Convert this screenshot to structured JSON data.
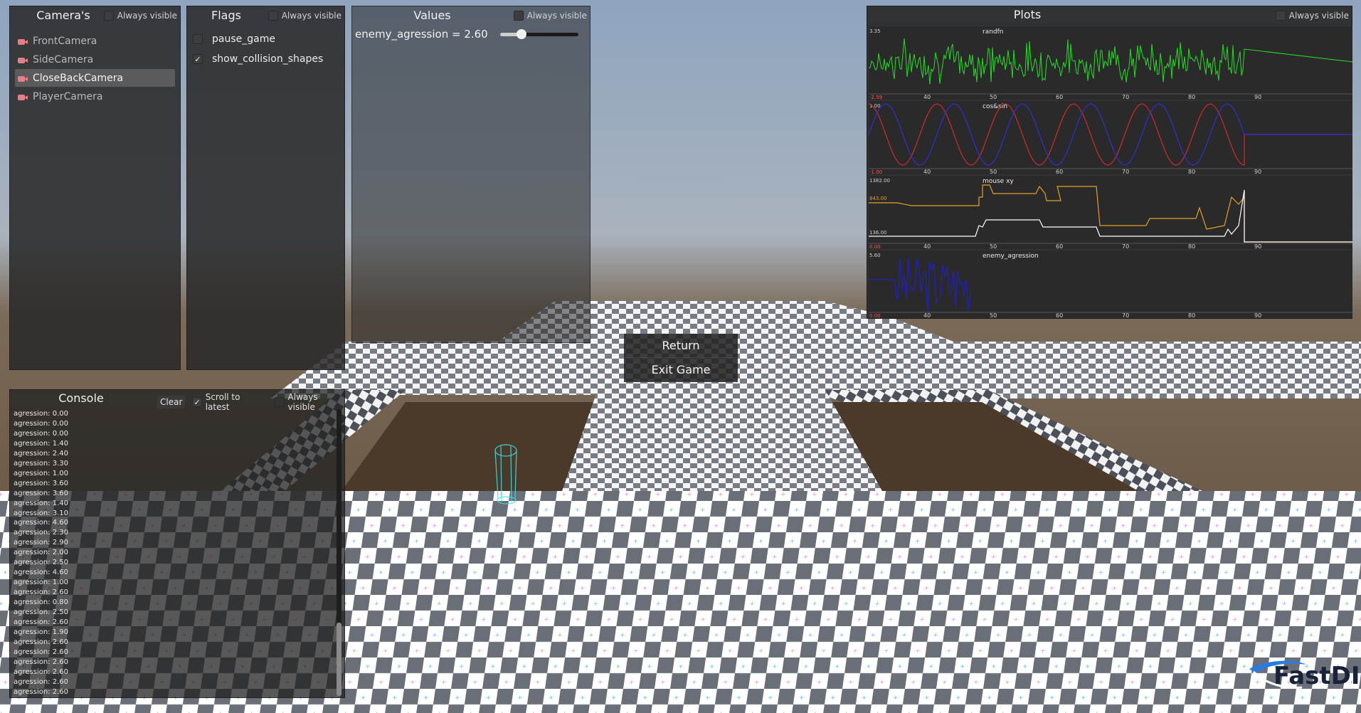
{
  "cameras": {
    "title": "Camera's",
    "always_visible": "Always visible",
    "items": [
      {
        "label": "FrontCamera",
        "active": false
      },
      {
        "label": "SideCamera",
        "active": false
      },
      {
        "label": "CloseBackCamera",
        "active": true
      },
      {
        "label": "PlayerCamera",
        "active": false
      }
    ]
  },
  "flags": {
    "title": "Flags",
    "always_visible": "Always visible",
    "items": [
      {
        "label": "pause_game",
        "checked": false
      },
      {
        "label": "show_collision_shapes",
        "checked": true
      }
    ]
  },
  "values": {
    "title": "Values",
    "always_visible": "Always visible",
    "label": "enemy_agression = 2.60",
    "slider_fraction": 0.27
  },
  "plots": {
    "title": "Plots",
    "always_visible": "Always visible",
    "x_ticks": [
      "40",
      "50",
      "60",
      "70",
      "80",
      "90"
    ],
    "graphs": [
      {
        "name": "randfn",
        "y_max": "3.35",
        "y_min": "-2.59",
        "color": "#22e022"
      },
      {
        "name": "cos&sin",
        "y_max": "1.00",
        "y_min": "-1.00",
        "colors": [
          "#d22a2a",
          "#2f2fd8"
        ]
      },
      {
        "name": "mouse xy",
        "y_max": "1382.00",
        "y_min": "0.00",
        "y_mid1": "843.00",
        "y_mid2": "136.00",
        "colors": [
          "#e5a020",
          "#ffffff"
        ]
      },
      {
        "name": "enemy_agression",
        "y_max": "5.60",
        "y_min": "0.00",
        "color": "#2020c8"
      }
    ]
  },
  "console": {
    "title": "Console",
    "clear_label": "Clear",
    "scroll_label": "Scroll to latest",
    "scroll_checked": true,
    "always_visible": "Always visible",
    "lines": [
      "agression: 0.00",
      "agression: 0.00",
      "agression: 0.00",
      "agression: 1.40",
      "agression: 2.40",
      "agression: 3.30",
      "agression: 1.00",
      "agression: 3.60",
      "agression: 3.60",
      "agression: 1.40",
      "agression: 3.10",
      "agression: 4.60",
      "agression: 2.30",
      "agression: 2.90",
      "agression: 2.00",
      "agression: 2.50",
      "agression: 4.60",
      "agression: 1.00",
      "agression: 2.60",
      "agression: 0.80",
      "agression: 2.50",
      "agression: 2.60",
      "agression: 1.90",
      "agression: 2.60",
      "agression: 2.60",
      "agression: 2.60",
      "agression: 2.60",
      "agression: 2.60",
      "agression: 2.60"
    ]
  },
  "menu": {
    "return_label": "Return",
    "exit_label": "Exit Game"
  },
  "logo": {
    "text": "FastDI"
  },
  "colors": {
    "sky_top": "#8ea4bf",
    "ground": "#6e5a46",
    "checker_dark": "#6a6e76",
    "checker_light": "#ffffff"
  }
}
